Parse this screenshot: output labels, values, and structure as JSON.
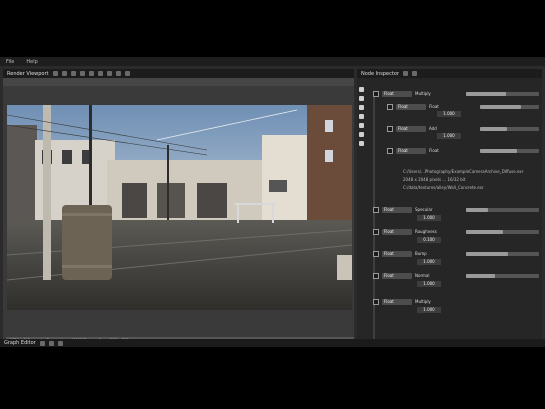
{
  "menu": [
    "File",
    "Help"
  ],
  "viewer": {
    "title": "Render Viewport"
  },
  "status": {
    "text": "w:1024 h:640  samples  Progressive   ...  MAXX/Camera  Kernel  512 x 256"
  },
  "node_editor": {
    "title": "Node Inspector"
  },
  "nodes": [
    {
      "type": "Float",
      "name": "Multiply"
    },
    {
      "type": "Float",
      "name": "Float"
    },
    {
      "type": "Float",
      "name": "Add"
    },
    {
      "type": "Float",
      "name": "Float"
    },
    {
      "type": "Float",
      "name": "Specular"
    },
    {
      "type": "Float",
      "name": "Roughness"
    },
    {
      "type": "Float",
      "name": "Bump"
    },
    {
      "type": "Float",
      "name": "Normal"
    },
    {
      "type": "Float",
      "name": "Multiply"
    }
  ],
  "values": [
    "1.000",
    "1.000",
    "1.000",
    "1.000",
    "0.100",
    "1.000",
    "1.000"
  ],
  "file_lines": [
    "C:/Users/...Photography/ExampleCameraArchive_Diffuse.exr",
    "2048 x 2048  pixels  ...  16/32 bit",
    "C:/data/textures/alley/Wall_Concrete.exr"
  ],
  "bottom": {
    "title": "Graph Editor"
  },
  "slider_levels": [
    0.55,
    0.7,
    0.45,
    0.62,
    0.3,
    0.5,
    0.58,
    0.4
  ]
}
